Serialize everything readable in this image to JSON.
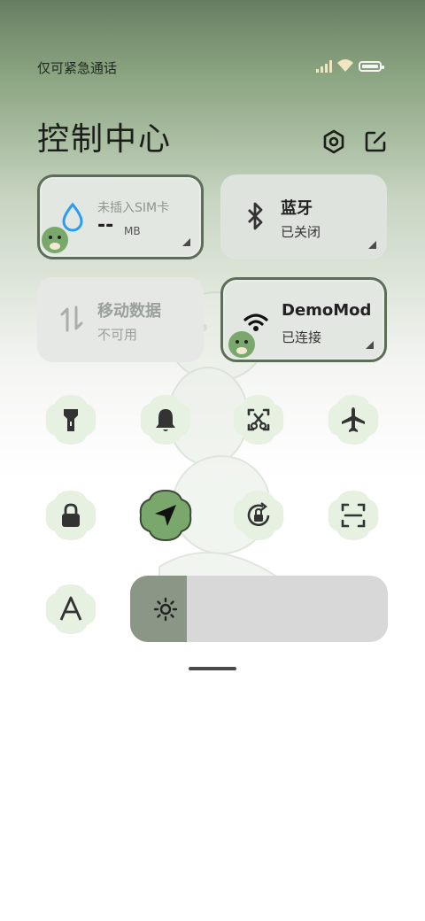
{
  "status_bar": {
    "carrier_text": "仅可紧急通话",
    "signal_icon": "signal-icon",
    "wifi_icon": "wifi-icon",
    "battery_icon": "battery-icon"
  },
  "header": {
    "title": "控制中心",
    "settings_icon": "settings-icon",
    "edit_icon": "edit-icon"
  },
  "tiles": {
    "data_usage": {
      "title": "未插入SIM卡",
      "value": "--",
      "unit": "MB",
      "icon": "water-drop-icon",
      "accent": "#2b9cf2"
    },
    "bluetooth": {
      "title": "蓝牙",
      "subtitle": "已关闭",
      "icon": "bluetooth-icon"
    },
    "mobile_data": {
      "title": "移动数据",
      "subtitle": "不可用",
      "icon": "mobile-data-icon"
    },
    "wifi": {
      "title": "DemoMod",
      "subtitle": "已连接",
      "icon": "wifi-icon"
    }
  },
  "toggles": [
    {
      "icon": "flashlight-icon",
      "active": false
    },
    {
      "icon": "bell-icon",
      "active": false
    },
    {
      "icon": "screenshot-icon",
      "active": false
    },
    {
      "icon": "airplane-icon",
      "active": false
    },
    {
      "icon": "lock-icon",
      "active": false
    },
    {
      "icon": "location-icon",
      "active": true
    },
    {
      "icon": "auto-rotate-icon",
      "active": false
    },
    {
      "icon": "scan-icon",
      "active": false
    },
    {
      "icon": "font-size-icon",
      "active": false
    }
  ],
  "brightness": {
    "icon": "sun-icon",
    "level_fraction": 0.22
  },
  "colors": {
    "active_toggle": "#7aa86c",
    "inactive_blob": "#e6f1e2",
    "slider_track": "#d8d8d8",
    "slider_fill": "#8a9786"
  }
}
